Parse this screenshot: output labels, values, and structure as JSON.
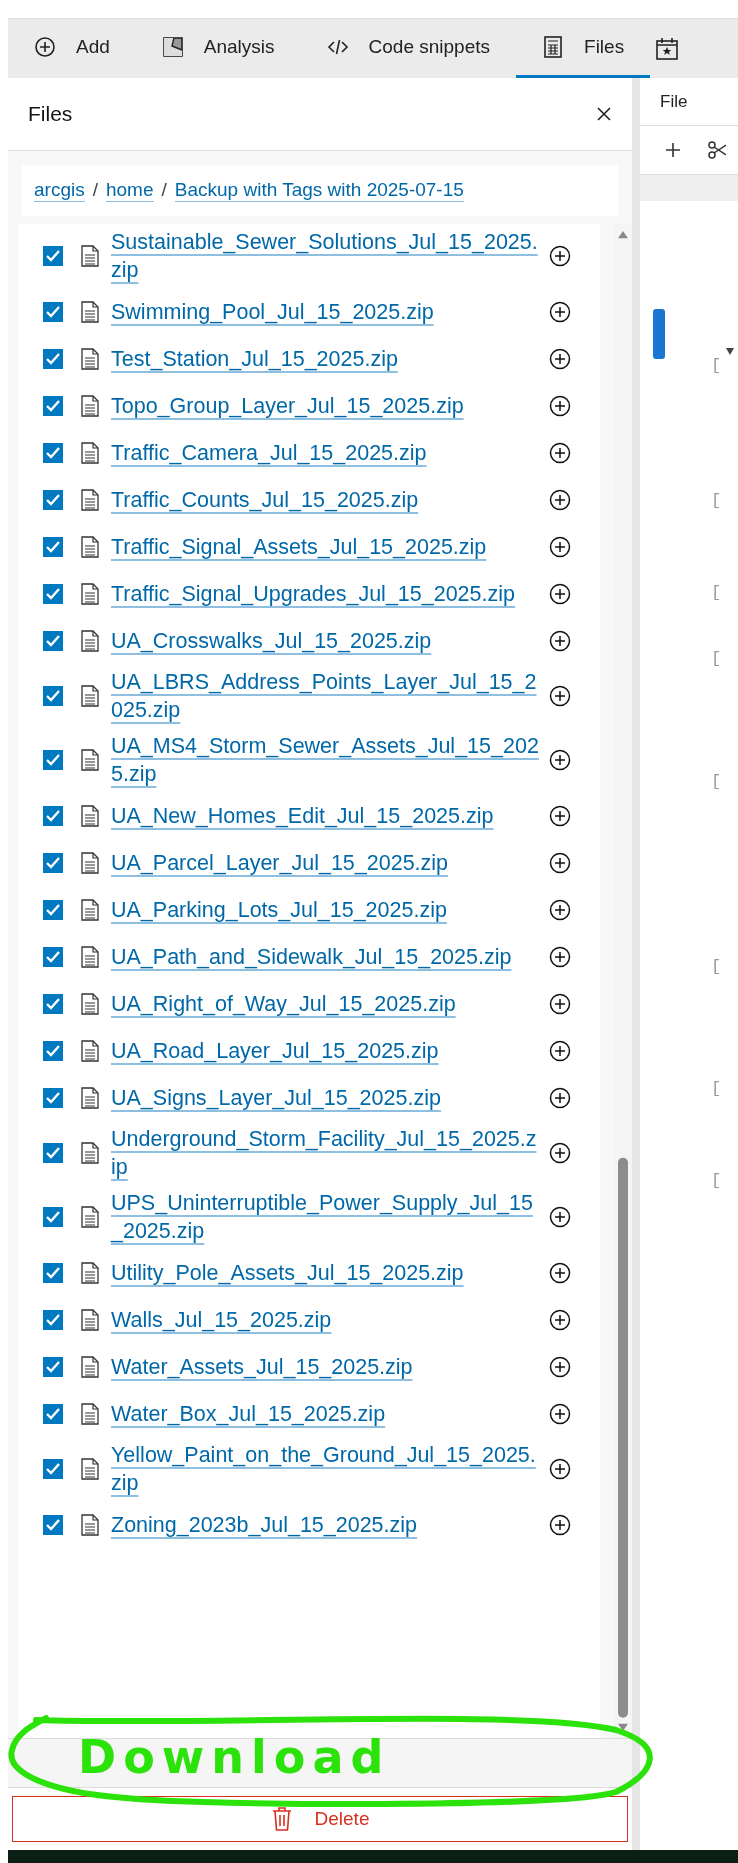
{
  "tabs": [
    {
      "label": "Add",
      "selected": false
    },
    {
      "label": "Analysis",
      "selected": false
    },
    {
      "label": "Code snippets",
      "selected": false
    },
    {
      "label": "Files",
      "selected": true
    }
  ],
  "panel": {
    "title": "Files",
    "breadcrumb": [
      {
        "kind": "link",
        "text": "arcgis"
      },
      {
        "kind": "separator",
        "text": "/"
      },
      {
        "kind": "link",
        "text": "home"
      },
      {
        "kind": "separator",
        "text": "/"
      },
      {
        "kind": "link",
        "text": "Backup with Tags with 2025-07-15"
      }
    ],
    "files": [
      {
        "name": "Sustainable_Sewer_Solutions_Jul_15_2025.zip",
        "checked": true
      },
      {
        "name": "Swimming_Pool_Jul_15_2025.zip",
        "checked": true
      },
      {
        "name": "Test_Station_Jul_15_2025.zip",
        "checked": true
      },
      {
        "name": "Topo_Group_Layer_Jul_15_2025.zip",
        "checked": true
      },
      {
        "name": "Traffic_Camera_Jul_15_2025.zip",
        "checked": true
      },
      {
        "name": "Traffic_Counts_Jul_15_2025.zip",
        "checked": true
      },
      {
        "name": "Traffic_Signal_Assets_Jul_15_2025.zip",
        "checked": true
      },
      {
        "name": "Traffic_Signal_Upgrades_Jul_15_2025.zip",
        "checked": true
      },
      {
        "name": "UA_Crosswalks_Jul_15_2025.zip",
        "checked": true
      },
      {
        "name": "UA_LBRS_Address_Points_Layer_Jul_15_2025.zip",
        "checked": true
      },
      {
        "name": "UA_MS4_Storm_Sewer_Assets_Jul_15_2025.zip",
        "checked": true
      },
      {
        "name": "UA_New_Homes_Edit_Jul_15_2025.zip",
        "checked": true
      },
      {
        "name": "UA_Parcel_Layer_Jul_15_2025.zip",
        "checked": true
      },
      {
        "name": "UA_Parking_Lots_Jul_15_2025.zip",
        "checked": true
      },
      {
        "name": "UA_Path_and_Sidewalk_Jul_15_2025.zip",
        "checked": true
      },
      {
        "name": "UA_Right_of_Way_Jul_15_2025.zip",
        "checked": true
      },
      {
        "name": "UA_Road_Layer_Jul_15_2025.zip",
        "checked": true
      },
      {
        "name": "UA_Signs_Layer_Jul_15_2025.zip",
        "checked": true
      },
      {
        "name": "Underground_Storm_Facility_Jul_15_2025.zip",
        "checked": true
      },
      {
        "name": "UPS_Uninterruptible_Power_Supply_Jul_15_2025.zip",
        "checked": true
      },
      {
        "name": "Utility_Pole_Assets_Jul_15_2025.zip",
        "checked": true
      },
      {
        "name": "Walls_Jul_15_2025.zip",
        "checked": true
      },
      {
        "name": "Water_Assets_Jul_15_2025.zip",
        "checked": true
      },
      {
        "name": "Water_Box_Jul_15_2025.zip",
        "checked": true
      },
      {
        "name": "Yellow_Paint_on_the_Ground_Jul_15_2025.zip",
        "checked": true
      },
      {
        "name": "Zoning_2023b_Jul_15_2025.zip",
        "checked": true
      }
    ],
    "delete_button": {
      "label": "Delete"
    }
  },
  "annotation": {
    "text": "Download"
  },
  "notebook": {
    "menu": [
      "File"
    ],
    "cell_prompts": [
      "[",
      "[",
      "[",
      "[",
      "[",
      "[",
      "[",
      "["
    ]
  }
}
